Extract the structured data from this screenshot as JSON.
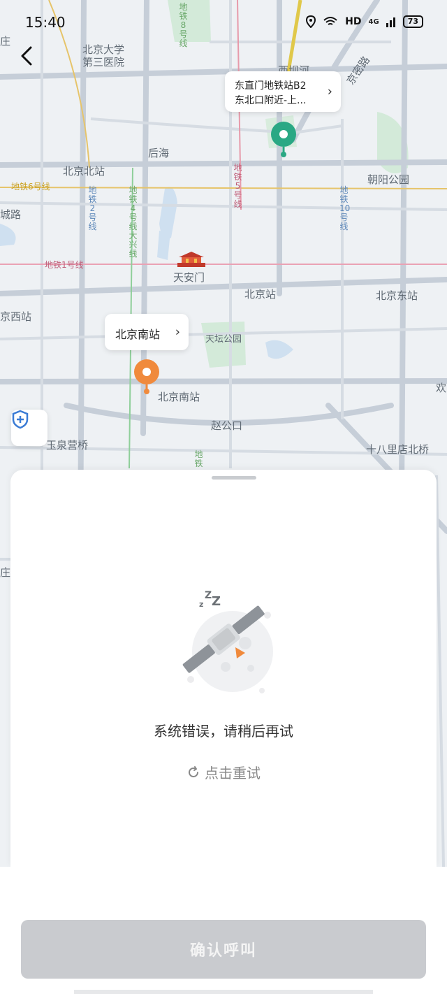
{
  "status": {
    "time": "15:40",
    "network": "HD",
    "signal": "4G",
    "battery": "73"
  },
  "map": {
    "labels": {
      "pku3": "北京大学\n第三医院",
      "houhai": "后海",
      "beijing_north": "北京北站",
      "metro6": "地铁6号线",
      "chaoyang_park": "朝阳公园",
      "xizhi": "城路",
      "metro1": "地铁1号线",
      "tiananmen": "天安门",
      "beijing_station": "北京站",
      "beijing_east": "北京东站",
      "beijing_west": "京西站",
      "temple_heaven": "天坛公园",
      "beijing_south": "北京南站",
      "zhaogongkou": "赵公口",
      "yuquanying": "玉泉营桥",
      "shibalidian": "十八里店北桥",
      "jingmi": "京密路",
      "xibahe": "西坝河",
      "huan": "欢",
      "zhuang": "庄",
      "zhuang2": "庄",
      "metro8": "地铁8号线",
      "metro5": "地铁5号线",
      "metro2": "地铁2号线",
      "metro4": "地铁4号线大兴线",
      "metro10": "地铁10号线",
      "metro13": "地铁"
    },
    "pickup_bubble": "北京南站",
    "dest_bubble_line1": "东直门地铁站B2",
    "dest_bubble_line2": "东北口附近-上..."
  },
  "sheet": {
    "error_message": "系统错误，请稍后再试",
    "retry_label": "点击重试"
  },
  "footer": {
    "confirm_label": "确认呼叫"
  },
  "colors": {
    "pickup": "#f08a3c",
    "destination": "#2aa884",
    "button_disabled": "#c9cbcf"
  }
}
